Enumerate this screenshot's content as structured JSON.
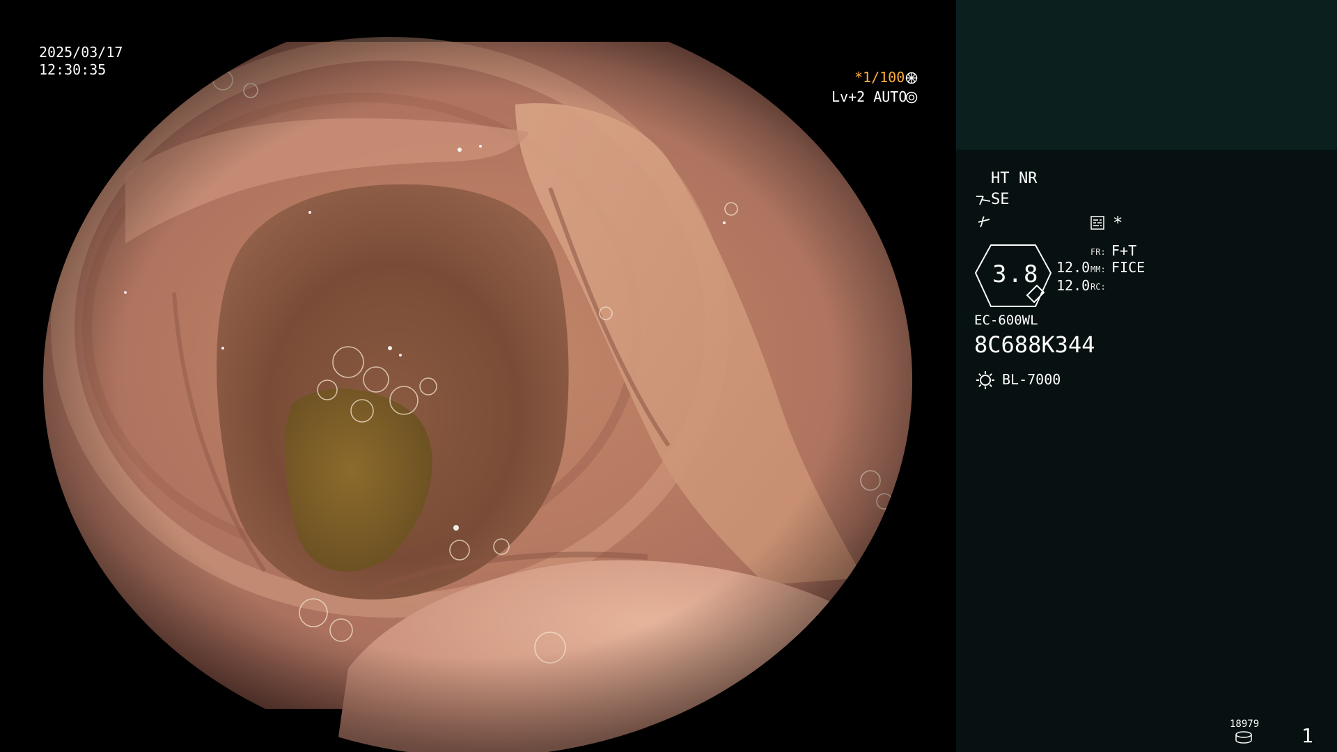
{
  "overlay": {
    "date": "2025/03/17",
    "time": "12:30:35",
    "shutter": "*1/100",
    "shutter_icon": "aperture-icon",
    "iris": "Lv+2 AUTO",
    "iris_icon": "iris-icon"
  },
  "panel": {
    "ht": "HT",
    "nr": "NR",
    "se": "SE",
    "se_icon": "se-icon",
    "enhance_icon": "enhance-icon",
    "memory_icon": "memory-icon",
    "asterisk": "*",
    "zoom_value": "3.8",
    "zoom_icon": "zoom-icon",
    "val1": "12.0",
    "val2": "12.0",
    "fr_label": "FR:",
    "fr_value": "F+T",
    "mm_label": "MM:",
    "mm_value": "FICE",
    "rc_label": "RC:",
    "rc_value": "",
    "scope_model": "EC-600WL",
    "serial": "8C688K344",
    "light_icon": "light-source-icon",
    "light_source": "BL-7000",
    "storage_count": "18979",
    "storage_icon": "storage-icon",
    "page_number": "1"
  },
  "colors": {
    "panel_bg": "#071111",
    "thumb_bg": "#0b1f1f",
    "accent_orange": "#ffae3a",
    "text_white": "#ffffff"
  }
}
